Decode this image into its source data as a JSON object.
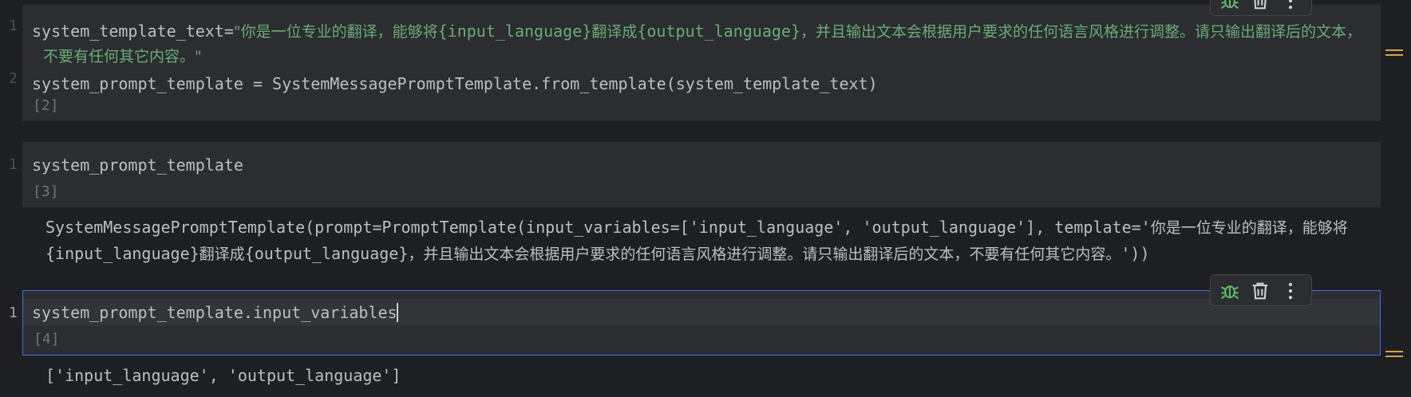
{
  "gutter": {
    "line1": "1",
    "line2": "2",
    "cell2_line1": "1",
    "cell3_line1": "1"
  },
  "cells": [
    {
      "code_line1_prefix": "system_template_text=",
      "code_line1_str_a": "\"你是一位专业的翻译，能够将",
      "code_line1_str_b": "{input_language}",
      "code_line1_str_c": "翻译成",
      "code_line1_str_d": "{output_language}",
      "code_line1_str_e": "，并且输出文本会根据用户要求的任何语言风格进行调整。请只输出翻译后的文本，",
      "code_line1_cont": "不要有任何其它内容。\"",
      "code_line2": "system_prompt_template = SystemMessagePromptTemplate.from_template(system_template_text)",
      "exec_count": "[2]"
    },
    {
      "code_line1": "system_prompt_template",
      "exec_count": "[3]",
      "output_line1_a": "SystemMessagePromptTemplate(prompt=PromptTemplate(input_variables=['input_language', 'output_language'], template='",
      "output_line1_b": "你是一位专业的翻译，能够将",
      "output_line2_a": "{input_language}",
      "output_line2_b": "翻译成",
      "output_line2_c": "{output_language}",
      "output_line2_d": "，并且输出文本会根据用户要求的任何语言风格进行调整。请只输出翻译后的文本，不要有任何其它内容。",
      "output_line2_e": "'))"
    },
    {
      "code_line1": "system_prompt_template.input_variables",
      "exec_count": "[4]",
      "output_line1": "['input_language', 'output_language']"
    }
  ],
  "toolbar_icons": {
    "debug": "bug-icon",
    "delete": "trash-icon",
    "more": "more-vertical-icon"
  },
  "colors": {
    "background": "#1e1f22",
    "cell_bg": "#2b2d30",
    "string": "#6aab73",
    "selected_border": "#3574f0",
    "debug_green": "#5fb865",
    "marker": "#d9a343"
  }
}
